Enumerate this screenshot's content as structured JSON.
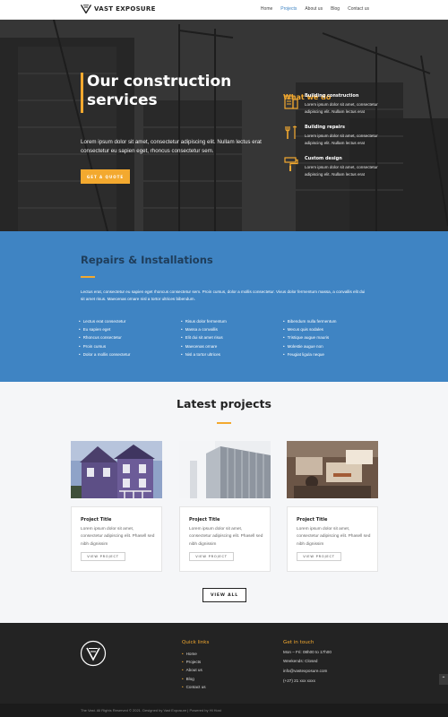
{
  "brand": {
    "name": "VAST EXPOSURE",
    "accent": "#f3a92f",
    "blue": "#3f84c3"
  },
  "nav": {
    "items": [
      "Home",
      "Projects",
      "About us",
      "Blog",
      "Contact us"
    ],
    "active": "Projects"
  },
  "hero": {
    "title": "Our construction services",
    "text": "Lorem ipsum dolor sit amet, consectetur adipiscing elit. Nullam lectus erat consectetur eu sapien eget, rhoncus consectetur sem.",
    "button": "GET A QUOTE",
    "what_we_do": "What we do",
    "services": [
      {
        "title": "Building construction",
        "text": "Lorem ipsum dolor sit amet, consectetur adipiscing elit. Nullam lectus erat",
        "icon": "building-icon"
      },
      {
        "title": "Building repairs",
        "text": "Lorem ipsum dolor sit amet, consectetur adipiscing elit. Nullam lectus erat",
        "icon": "tools-icon"
      },
      {
        "title": "Custom design",
        "text": "Lorem ipsum dolor sit amet, consectetur adipiscing elit. Nullam lectus erat",
        "icon": "paint-roller-icon"
      }
    ]
  },
  "repairs": {
    "title": "Repairs & Installations",
    "text": "Lectus erat, consectetur eu sapien eget rhoncus consectetur sem. Proin cursus, dolor a mollis consectetur. Vivus dolor fermentum massa, a convallis elit dui sit amet risus. Maecenas ornare nisl a tortor ultrices bibendum.",
    "columns": [
      [
        "Lectus erat consectetur",
        "Eu sapien eget",
        "Rhoncus consectetur",
        "Proin cursus",
        "Dolor a mollis consectetur"
      ],
      [
        "Risus dolor fermentum",
        "Massa a convallis",
        "Elit dui sit amet risus",
        "Maecenas ornare",
        "Nisl a tortor ultrices"
      ],
      [
        "Bibendum nulla fermentum",
        "Mecus quis sodales",
        "Tristique augue mauris",
        "Molestie augue non",
        "Feugiat ligula neque"
      ]
    ]
  },
  "projects": {
    "title": "Latest projects",
    "cards": [
      {
        "title": "Project Title",
        "text": "Lorem ipsum dolor sit amet, consectetur adipiscing elit. Phasell sed nibh dignissim",
        "button": "VIEW PROJECT"
      },
      {
        "title": "Project Title",
        "text": "Lorem ipsum dolor sit amet, consectetur adipiscing elit. Phasell sed nibh dignissim",
        "button": "VIEW PROJECT"
      },
      {
        "title": "Project Title",
        "text": "Lorem ipsum dolor sit amet, consectetur adipiscing elit. Phasell sed nibh dignissim",
        "button": "VIEW PROJECT"
      }
    ],
    "view_all": "VIEW ALL"
  },
  "footer": {
    "quick_links_title": "Quick links",
    "links": [
      "Home",
      "Projects",
      "About us",
      "Blog",
      "Contact us"
    ],
    "contact_title": "Get in touch",
    "hours": "Mon – Fri: 08h00 to 17h00",
    "weekends": "Weekends: Closed",
    "email": "info@vastexposure.com",
    "phone": "(+27) 21 xxx xxxx",
    "copyright": "The Vast. All Rights Reserved © 2021. Designed by Vast Exposure | Powered by Hi Host"
  }
}
